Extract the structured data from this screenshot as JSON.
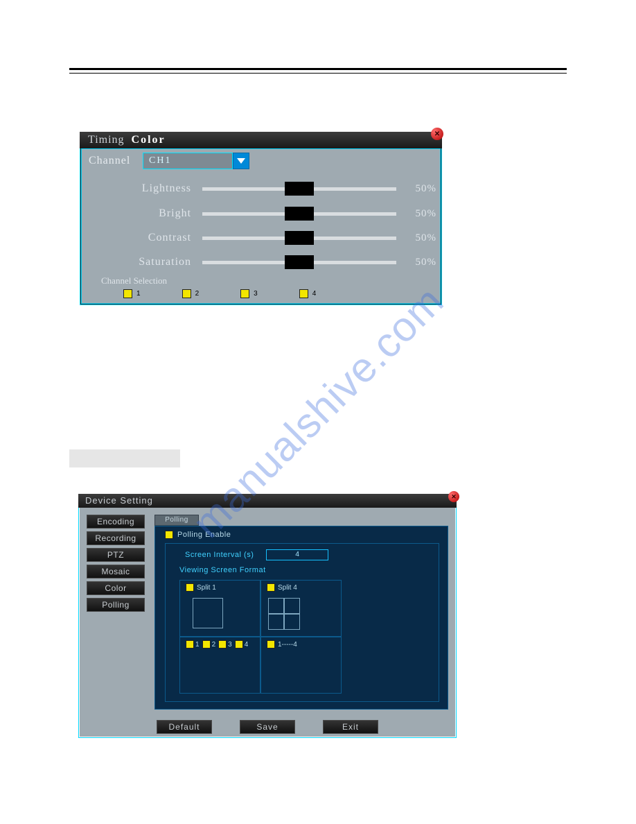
{
  "timing_color": {
    "title_a": "Timing",
    "title_b": "Color",
    "channel_label": "Channel",
    "channel_value": "CH1",
    "sliders": {
      "lightness": {
        "label": "Lightness",
        "value": "50%"
      },
      "bright": {
        "label": "Bright",
        "value": "50%"
      },
      "contrast": {
        "label": "Contrast",
        "value": "50%"
      },
      "saturation": {
        "label": "Saturation",
        "value": "50%"
      }
    },
    "channel_selection_label": "Channel Selection",
    "channels": [
      "1",
      "2",
      "3",
      "4"
    ]
  },
  "device_setting": {
    "title": "Device Setting",
    "sidebar": [
      "Encoding",
      "Recording",
      "PTZ",
      "Mosaic",
      "Color",
      "Polling"
    ],
    "tab": "Polling",
    "polling_enable": "Polling Enable",
    "screen_interval_label": "Screen Interval (s)",
    "screen_interval_value": "4",
    "viewing_header": "Viewing Screen Format",
    "split1": "Split 1",
    "split4": "Split 4",
    "row2_left_items": [
      "1",
      "2",
      "3",
      "4"
    ],
    "row2_right": "1-----4",
    "buttons": {
      "default": "Default",
      "save": "Save",
      "exit": "Exit"
    }
  }
}
